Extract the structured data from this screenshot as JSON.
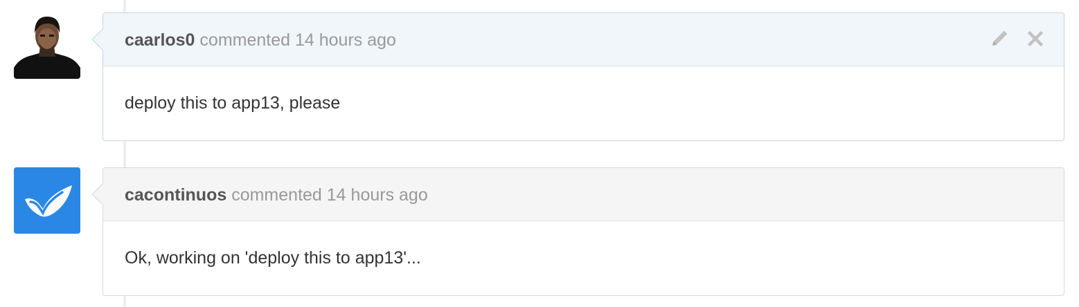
{
  "comments": [
    {
      "author": "caarlos0",
      "verb": "commented",
      "time": "14 hours ago",
      "body": "deploy this to app13, please",
      "avatar": "user-photo",
      "actions": [
        "edit-icon",
        "close-icon"
      ]
    },
    {
      "author": "cacontinuos",
      "verb": "commented",
      "time": "14 hours ago",
      "body": "Ok, working on 'deploy this to app13'...",
      "avatar": "checkmark-logo",
      "avatar_color": "#2b87e5"
    }
  ],
  "colors": {
    "timeline": "#eeeeee",
    "owner_header_bg": "#f1f6fa",
    "other_header_bg": "#f5f5f5",
    "muted_text": "#999999",
    "author_text": "#555555",
    "body_text": "#333333"
  }
}
